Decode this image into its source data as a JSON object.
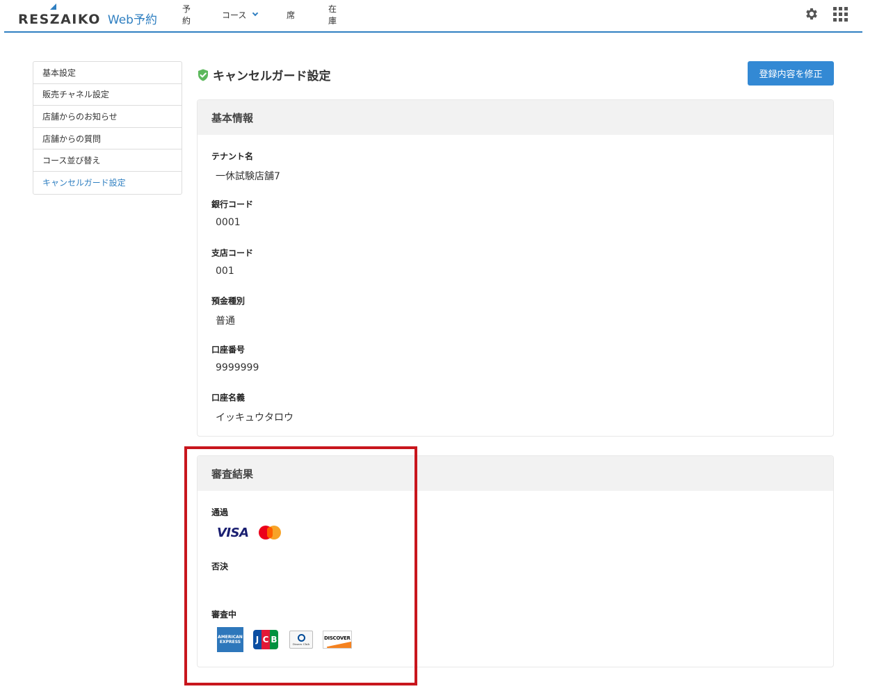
{
  "brand": {
    "name": "RESZAIKO",
    "sub": "Web予約",
    "accent": "#2f7fc1"
  },
  "nav": {
    "items": [
      {
        "label": "予約"
      },
      {
        "label": "コース"
      },
      {
        "label": "席"
      },
      {
        "label": "在庫"
      }
    ]
  },
  "header_icons": [
    "gear-icon",
    "apps-grid-icon"
  ],
  "sidebar": {
    "items": [
      {
        "label": "基本設定"
      },
      {
        "label": "販売チャネル設定"
      },
      {
        "label": "店舗からのお知らせ"
      },
      {
        "label": "店舗からの質問"
      },
      {
        "label": "コース並び替え"
      },
      {
        "label": "キャンセルガード設定",
        "active": true
      }
    ]
  },
  "page": {
    "title": "キャンセルガード設定",
    "edit_button": "登録内容を修正"
  },
  "basic_info": {
    "heading": "基本情報",
    "fields": [
      {
        "label": "テナント名",
        "value": "一休試験店舗7"
      },
      {
        "label": "銀行コード",
        "value": "0001"
      },
      {
        "label": "支店コード",
        "value": "001"
      },
      {
        "label": "預金種別",
        "value": "普通"
      },
      {
        "label": "口座番号",
        "value": "9999999"
      },
      {
        "label": "口座名義",
        "value": "イッキュウタロウ"
      }
    ]
  },
  "review": {
    "heading": "審査結果",
    "approved_label": "通過",
    "rejected_label": "否決",
    "pending_label": "審査中",
    "approved_cards": [
      "VISA",
      "Mastercard"
    ],
    "pending_cards": [
      "AMERICAN EXPRESS",
      "JCB",
      "Diners Club",
      "DISCOVER"
    ],
    "amex_text": "AMERICAN EXPRESS",
    "jcb_letters": [
      "J",
      "C",
      "B"
    ],
    "diners_text": "Diners Club",
    "discover_text": "DISCOVER",
    "visa_text": "VISA"
  },
  "colors": {
    "primary_button": "#3389d4",
    "highlight_box": "#c8161d",
    "check": "#5cb85c"
  }
}
